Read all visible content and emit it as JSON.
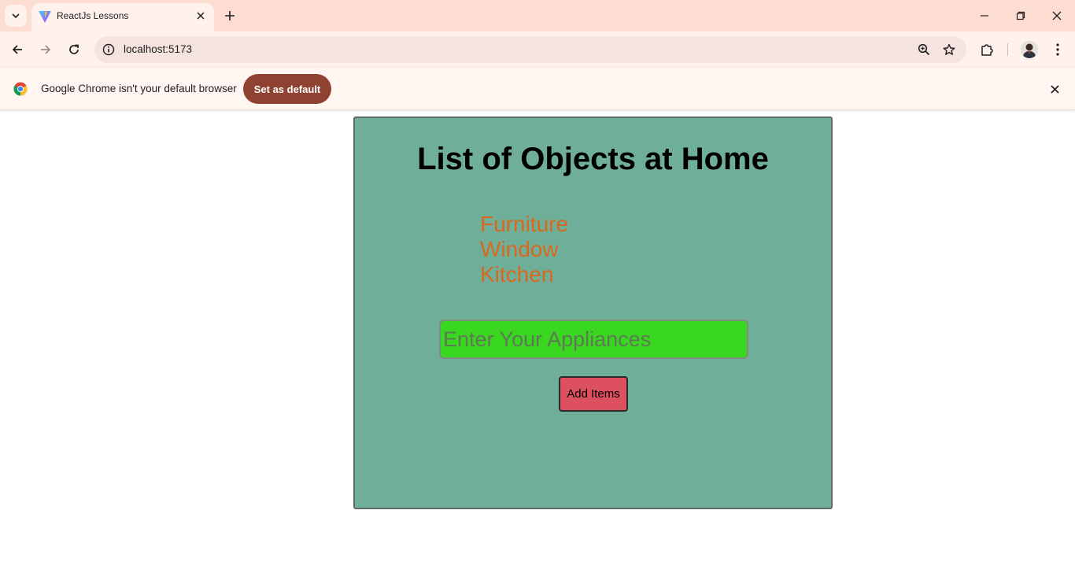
{
  "browser": {
    "tab_title": "ReactJs Lessons",
    "url": "localhost:5173",
    "infobar": {
      "message": "Google Chrome isn't your default browser",
      "button_label": "Set as default"
    },
    "colors": {
      "tabstrip": "#fddcd2",
      "toolbar": "#fff1ec",
      "infobar_button": "#8f4232"
    }
  },
  "app": {
    "title": "List of Objects at Home",
    "items": [
      "Furniture",
      "Window",
      "Kitchen"
    ],
    "input": {
      "placeholder": "Enter Your Appliances",
      "value": ""
    },
    "add_button_label": "Add Items",
    "colors": {
      "card_background": "#6faf9a",
      "item_text": "#d8681d",
      "input_background": "#39d71f",
      "button_background": "#dc5060"
    }
  }
}
